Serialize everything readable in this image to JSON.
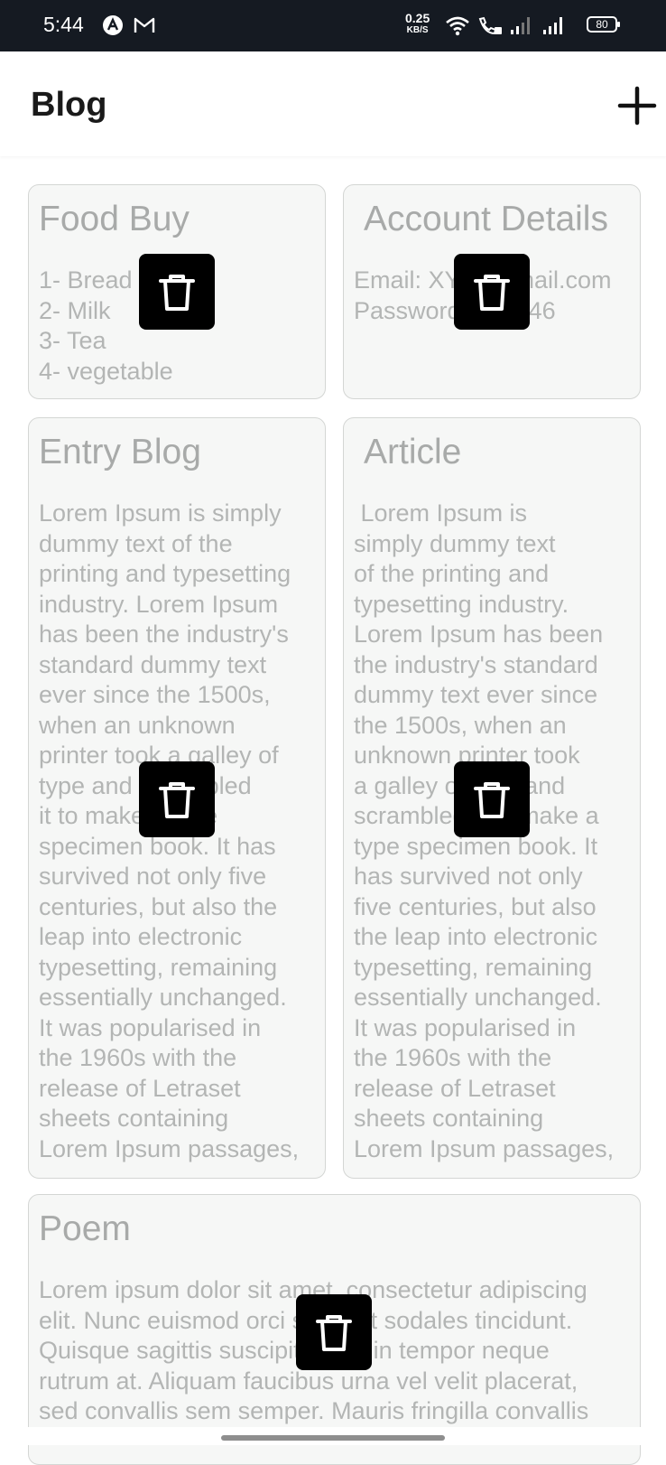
{
  "status_bar": {
    "time": "5:44",
    "speed_value": "0.25",
    "speed_unit": "KB/S",
    "battery": "80"
  },
  "app_bar": {
    "title": "Blog",
    "add_icon": "plus-icon"
  },
  "notes": [
    {
      "title": "Food Buy",
      "body": "1- Bread\n2- Milk\n3- Tea\n4- vegetable"
    },
    {
      "title": "Account Details",
      "body": "Email: XYZ@gmail.com\nPassword: 123446"
    },
    {
      "title": "Entry Blog",
      "body": "Lorem Ipsum is simply\ndummy text of the\nprinting and typesetting\nindustry. Lorem Ipsum\nhas been the industry's\nstandard dummy text\never since the 1500s,\nwhen an unknown\nprinter took a galley of\ntype and scrambled\nit to make a type\nspecimen book. It has\nsurvived not only five\ncenturies, but also the\nleap into electronic\ntypesetting, remaining\nessentially unchanged.\nIt was popularised in\nthe 1960s with the\nrelease of Letraset\nsheets containing\nLorem Ipsum passages,"
    },
    {
      "title": "Article",
      "body": " Lorem Ipsum is\nsimply dummy text\nof the printing and\ntypesetting industry.\nLorem Ipsum has been\nthe industry's standard\ndummy text ever since\nthe 1500s, when an\nunknown printer took\na galley of type and\nscrambled it to make a\ntype specimen book. It\nhas survived not only\nfive centuries, but also\nthe leap into electronic\ntypesetting, remaining\nessentially unchanged.\nIt was popularised in\nthe 1960s with the\nrelease of Letraset\nsheets containing\nLorem Ipsum passages,"
    },
    {
      "title": "Poem",
      "body": "Lorem ipsum dolor sit amet, consectetur adipiscing\nelit. Nunc euismod orci sit amet sodales tincidunt.\nQuisque sagittis suscipit diam, in tempor neque\nrutrum at. Aliquam faucibus urna vel velit placerat,\nsed convallis sem semper. Mauris fringilla convallis"
    }
  ],
  "icons": {
    "delete": "trash-icon"
  },
  "colors": {
    "status_bar": "#151a22",
    "card_background": "#f6f7f6",
    "card_text": "#b3b5b4",
    "delete_button": "#000000"
  }
}
